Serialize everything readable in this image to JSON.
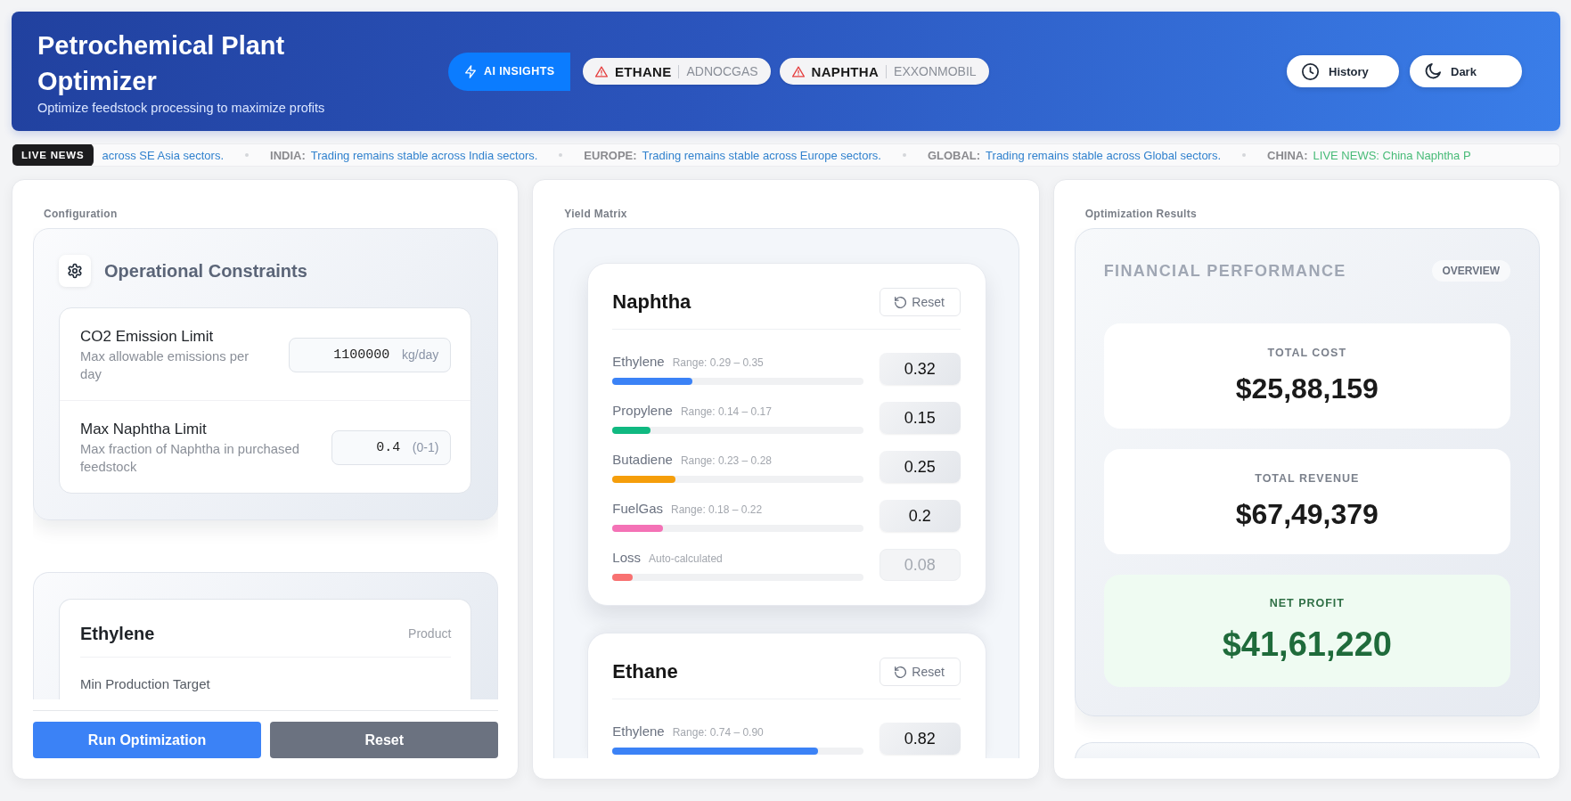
{
  "header": {
    "title": "Petrochemical Plant Optimizer",
    "subtitle": "Optimize feedstock processing to maximize profits"
  },
  "insights": {
    "label": "AI INSIGHTS",
    "alerts": [
      {
        "product": "ETHANE",
        "source": "ADNOCGAS"
      },
      {
        "product": "NAPHTHA",
        "source": "EXXONMOBIL"
      }
    ]
  },
  "header_actions": [
    {
      "kind": "history",
      "label": "History"
    },
    {
      "kind": "theme",
      "label": "Dark"
    }
  ],
  "news_ticker": {
    "badge": "LIVE NEWS",
    "items": [
      {
        "message": "across SE Asia sectors.",
        "color": "#3182ce"
      },
      {
        "region": "INDIA:",
        "message": "Trading remains stable across India sectors.",
        "color": "#3182ce"
      },
      {
        "region": "EUROPE:",
        "message": "Trading remains stable across Europe sectors.",
        "color": "#3182ce"
      },
      {
        "region": "GLOBAL:",
        "message": "Trading remains stable across Global sectors.",
        "color": "#3182ce"
      },
      {
        "region": "CHINA:",
        "message": "LIVE NEWS: China Naphtha P",
        "color": "#48bb78"
      }
    ]
  },
  "configuration": {
    "title": "Configuration",
    "constraints": {
      "title": "Operational Constraints",
      "fields": [
        {
          "label": "CO2 Emission Limit",
          "description": "Max allowable emissions per day",
          "value": "1100000",
          "unit": "kg/day"
        },
        {
          "label": "Max Naphtha Limit",
          "description": "Max fraction of Naphtha in purchased feedstock",
          "value": "0.4",
          "unit": "(0-1)"
        }
      ]
    },
    "products": [
      {
        "name": "Ethylene",
        "type": "Product",
        "fields": [
          {
            "label": "Min Production Target"
          }
        ]
      }
    ],
    "buttons": [
      {
        "kind": "run",
        "label": "Run Optimization"
      },
      {
        "kind": "reset",
        "label": "Reset"
      }
    ]
  },
  "yield_matrix": {
    "title": "Yield Matrix",
    "feeds": [
      {
        "name": "Naphtha",
        "reset_label": "Reset",
        "yields": [
          {
            "product": "Ethylene",
            "note": "Range: 0.29 – 0.35",
            "value": "0.32",
            "level": 0.32,
            "color": "#3b82f6",
            "disabled": false
          },
          {
            "product": "Propylene",
            "note": "Range: 0.14 – 0.17",
            "value": "0.15",
            "level": 0.15,
            "color": "#10b981",
            "disabled": false
          },
          {
            "product": "Butadiene",
            "note": "Range: 0.23 – 0.28",
            "value": "0.25",
            "level": 0.25,
            "color": "#f59e0b",
            "disabled": false
          },
          {
            "product": "FuelGas",
            "note": "Range: 0.18 – 0.22",
            "value": "0.2",
            "level": 0.2,
            "color": "#f472b6",
            "disabled": false
          },
          {
            "product": "Loss",
            "note": "Auto-calculated",
            "value": "0.08",
            "level": 0.08,
            "color": "#f87171",
            "disabled": true
          }
        ]
      },
      {
        "name": "Ethane",
        "reset_label": "Reset",
        "yields": [
          {
            "product": "Ethylene",
            "note": "Range: 0.74 – 0.90",
            "value": "0.82",
            "level": 0.82,
            "color": "#3b82f6",
            "disabled": false
          }
        ]
      }
    ]
  },
  "results": {
    "title": "Optimization Results",
    "panel": {
      "title": "FINANCIAL PERFORMANCE",
      "badge": "OVERVIEW",
      "metrics": [
        {
          "kind": "neutral",
          "label": "TOTAL COST",
          "value": "$25,88,159"
        },
        {
          "kind": "neutral",
          "label": "TOTAL REVENUE",
          "value": "$67,49,379"
        },
        {
          "kind": "profit",
          "label": "NET PROFIT",
          "value": "$41,61,220"
        }
      ]
    }
  }
}
